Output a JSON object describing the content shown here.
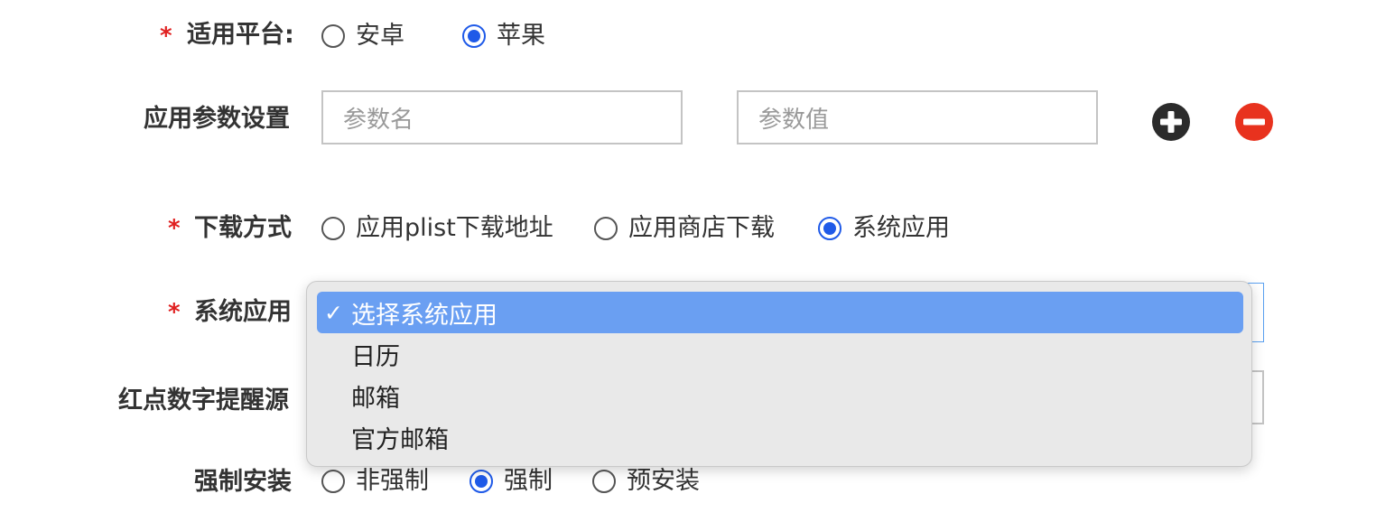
{
  "form": {
    "platform": {
      "label": "适用平台:",
      "options": [
        {
          "label": "安卓",
          "checked": false
        },
        {
          "label": "苹果",
          "checked": true
        }
      ]
    },
    "params": {
      "label": "应用参数设置",
      "name_placeholder": "参数名",
      "value_placeholder": "参数值",
      "add_icon": "plus-circle-icon",
      "remove_icon": "minus-circle-icon"
    },
    "download": {
      "label": "下载方式",
      "options": [
        {
          "label": "应用plist下载地址",
          "checked": false
        },
        {
          "label": "应用商店下载",
          "checked": false
        },
        {
          "label": "系统应用",
          "checked": true
        }
      ]
    },
    "system_app": {
      "label": "系统应用",
      "dropdown": {
        "check_mark": "✓",
        "options": [
          {
            "label": "选择系统应用",
            "selected": true
          },
          {
            "label": "日历",
            "selected": false
          },
          {
            "label": "邮箱",
            "selected": false
          },
          {
            "label": "官方邮箱",
            "selected": false
          }
        ]
      }
    },
    "badge_source": {
      "label": "红点数字提醒源"
    },
    "force_install": {
      "label": "强制安装",
      "options": [
        {
          "label": "非强制",
          "checked": false
        },
        {
          "label": "强制",
          "checked": true
        },
        {
          "label": "预安装",
          "checked": false
        }
      ]
    },
    "required_mark": "*"
  },
  "colors": {
    "accent": "#1f5ae8",
    "required": "#e02020",
    "add_button": "#2b2b2b",
    "remove_button": "#e8321e",
    "highlight": "#6a9ff2"
  }
}
